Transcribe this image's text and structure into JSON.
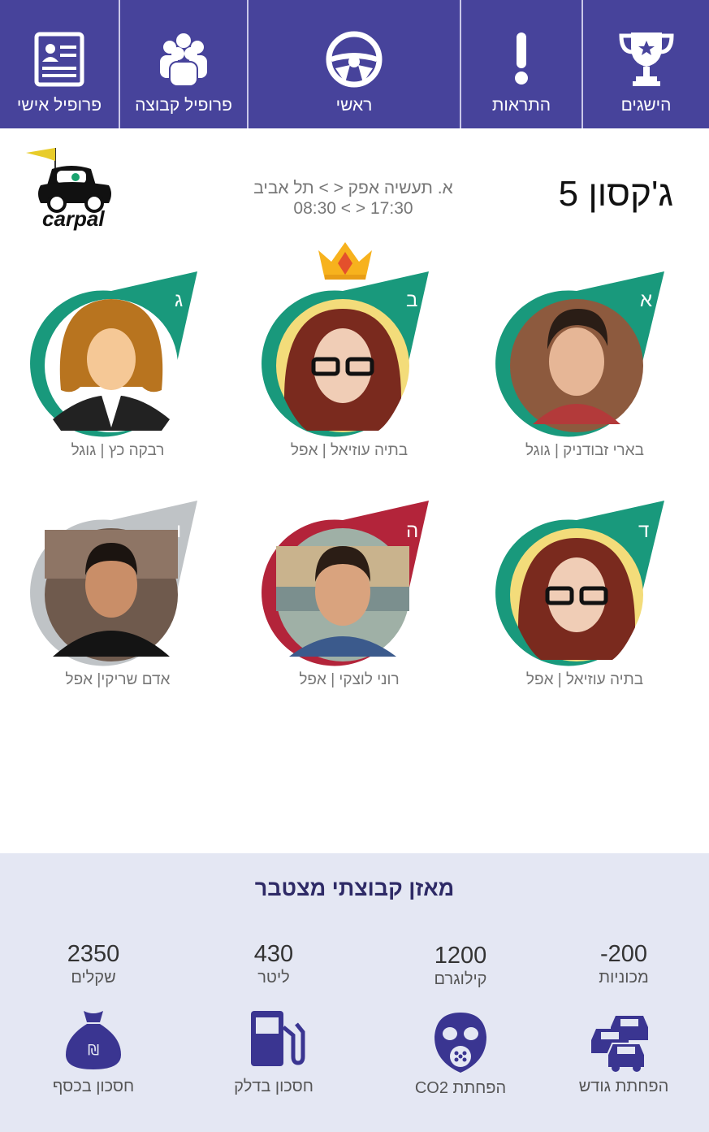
{
  "nav": {
    "items": [
      {
        "label": "פרופיל אישי",
        "icon": "profile-card-icon"
      },
      {
        "label": "פרופיל קבוצה",
        "icon": "group-icon"
      },
      {
        "label": "ראשי",
        "icon": "steering-wheel-icon"
      },
      {
        "label": "התראות",
        "icon": "exclamation-icon"
      },
      {
        "label": "הישגים",
        "icon": "trophy-icon"
      }
    ],
    "background_color": "#47439b"
  },
  "header": {
    "group_name": "ג'קסון 5",
    "route_line": "א. תעשיה אפק < > תל אביב",
    "time_line": "08:30 < > 17:30",
    "logo_text": "carpal"
  },
  "members": [
    {
      "letter": "א",
      "name": "בארי זבודניק | גוגל",
      "status_color": "#19997c"
    },
    {
      "letter": "ב",
      "name": "בתיה עוזיאל | אפל",
      "status_color": "#19997c",
      "crown": true
    },
    {
      "letter": "ג",
      "name": "רבקה כץ | גוגל",
      "status_color": "#19997c"
    },
    {
      "letter": "ד",
      "name": "בתיה עוזיאל | אפל",
      "status_color": "#19997c"
    },
    {
      "letter": "ה",
      "name": "רוני לוצקי | אפל",
      "status_color": "#b3243a"
    },
    {
      "letter": "ו",
      "name": "אדם שריקי| אפל",
      "status_color": "#bfc3c6"
    }
  ],
  "balance": {
    "title": "מאזן קבוצתי מצטבר",
    "stats": [
      {
        "value": "-200",
        "unit": "מכוניות",
        "caption": "הפחתת גודש",
        "icon": "cars-icon"
      },
      {
        "value": "1200",
        "unit": "קילוגרם",
        "caption": "הפחתת CO2",
        "icon": "gas-mask-icon"
      },
      {
        "value": "430",
        "unit": "ליטר",
        "caption": "חסכון בדלק",
        "icon": "fuel-pump-icon"
      },
      {
        "value": "2350",
        "unit": "שקלים",
        "caption": "חסכון בכסף",
        "icon": "money-bag-icon"
      }
    ]
  }
}
